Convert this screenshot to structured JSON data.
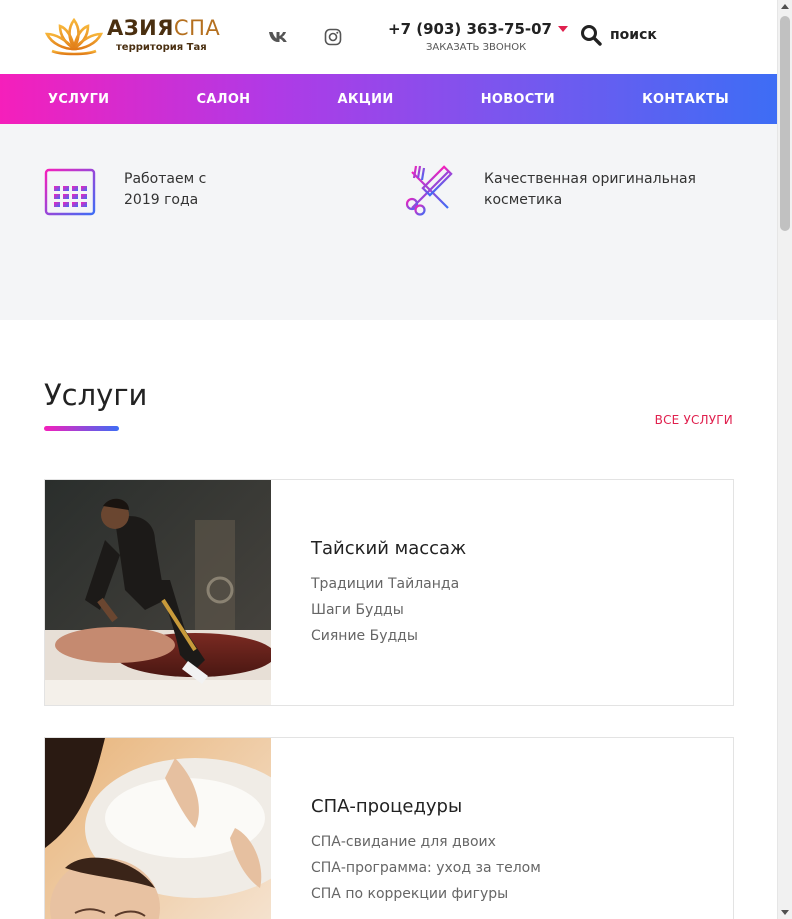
{
  "header": {
    "logo_main": "АЗИЯ",
    "logo_accent": "СПА",
    "logo_sub": "территория Тая",
    "phone": "+7 (903) 363-75-07",
    "callback": "ЗАКАЗАТЬ ЗВОНОК",
    "search_label": "поиск"
  },
  "nav": {
    "items": [
      {
        "label": "УСЛУГИ"
      },
      {
        "label": "САЛОН"
      },
      {
        "label": "АКЦИИ"
      },
      {
        "label": "НОВОСТИ"
      },
      {
        "label": "КОНТАКТЫ"
      }
    ]
  },
  "features": [
    {
      "icon": "calendar-icon",
      "text": "Работаем с 2019 года"
    },
    {
      "icon": "scissors-comb-icon",
      "text": "Качественная оригинальная косметика"
    }
  ],
  "services": {
    "title": "Услуги",
    "all_link": "ВСЕ УСЛУГИ",
    "cards": [
      {
        "title": "Тайский массаж",
        "image": "thai-massage-photo",
        "items": [
          "Традиции Тайланда",
          "Шаги Будды",
          "Сияние Будды"
        ]
      },
      {
        "title": "СПА-процедуры",
        "image": "spa-procedure-photo",
        "items": [
          "СПА-свидание для двоих",
          "СПА-программа: уход за телом",
          "СПА по коррекции фигуры"
        ]
      }
    ]
  },
  "colors": {
    "accent_pink": "#f51fbb",
    "accent_blue": "#3d6df5",
    "link_red": "#e0204e",
    "logo_brown": "#4a2f10",
    "logo_orange": "#e8951f"
  }
}
